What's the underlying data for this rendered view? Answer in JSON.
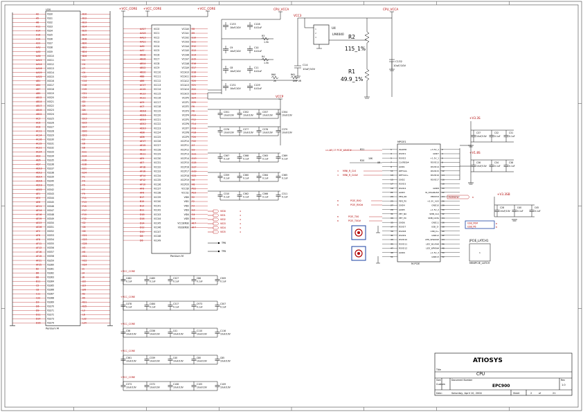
{
  "title_block": {
    "company": "ATIOSYS",
    "sheet_title": "CPU",
    "title_label": "Title",
    "size_label": "Size",
    "size_value": "Custom",
    "doc_label": "Document Number",
    "doc_number": "EPC900",
    "rev_label": "Rev",
    "rev_value": "1.0",
    "date_label": "Date:",
    "date_value": "Saturday, April 10, 2004",
    "sheet_label": "Sheet",
    "sheet_num": "2",
    "of_label": "of",
    "sheet_total": "21"
  },
  "rails": {
    "vcc_core_1": "+VCC_CORE",
    "vcc_core_2": "+VCC_CORE",
    "vcc_core_3": "+VCC_CORE",
    "cpu_vcca_1": "CPU_VCCA",
    "cpu_vcca_2": "CPU_VCCA",
    "vcc3": "VCC3",
    "vccp": "VCCP",
    "v3_3sb": "+V3.3S",
    "v1_8s": "+V1.8S",
    "v3_3sb_2": "+V3.3SB"
  },
  "left_part": {
    "ref": "U20",
    "caption": "Pentium M",
    "rows": [
      [
        "A2",
        "VSS0",
        "B10"
      ],
      [
        "A5",
        "VSS1",
        "B12"
      ],
      [
        "A8",
        "VSS2",
        "B13"
      ],
      [
        "A11",
        "VSS3",
        "B14"
      ],
      [
        "A14",
        "VSS4",
        "B15"
      ],
      [
        "A16",
        "VSS5",
        "B17"
      ],
      [
        "A19",
        "VSS6",
        "B18"
      ],
      [
        "A23",
        "VSS7",
        "B20"
      ],
      [
        "AA2",
        "VSS8",
        "B22"
      ],
      [
        "AA5",
        "VSS9",
        "B24"
      ],
      [
        "AA8",
        "VSS10",
        "B26"
      ],
      [
        "AA11",
        "VSS11",
        "C1"
      ],
      [
        "AA14",
        "VSS12",
        "C4"
      ],
      [
        "AA16",
        "VSS13",
        "C7"
      ],
      [
        "AA19",
        "VSS14",
        "C9"
      ],
      [
        "AA22",
        "VSS15",
        "C12"
      ],
      [
        "AB1",
        "VSS16",
        "C14"
      ],
      [
        "AB4",
        "VSS17",
        "C16"
      ],
      [
        "AB7",
        "VSS18",
        "C19"
      ],
      [
        "AB9",
        "VSS19",
        "C21"
      ],
      [
        "AB12",
        "VSS20",
        "C24"
      ],
      [
        "AB14",
        "VSS21",
        "D2"
      ],
      [
        "AB17",
        "VSS22",
        "D5"
      ],
      [
        "AB19",
        "VSS23",
        "D8"
      ],
      [
        "AB22",
        "VSS24",
        "D10"
      ],
      [
        "AC3",
        "VSS25",
        "D13"
      ],
      [
        "AC6",
        "VSS26",
        "D15"
      ],
      [
        "AC8",
        "VSS27",
        "D17"
      ],
      [
        "AC11",
        "VSS28",
        "D20"
      ],
      [
        "AC14",
        "VSS29",
        "D23"
      ],
      [
        "AC16",
        "VSS30",
        "E3"
      ],
      [
        "AC19",
        "VSS31",
        "E6"
      ],
      [
        "AC21",
        "VSS32",
        "E8"
      ],
      [
        "AC24",
        "VSS33",
        "E11"
      ],
      [
        "AD2",
        "VSS34",
        "E14"
      ],
      [
        "AD5",
        "VSS35",
        "E16"
      ],
      [
        "AD7",
        "VSS36",
        "E18"
      ],
      [
        "AD10",
        "VSS37",
        "E21"
      ],
      [
        "AD12",
        "VSS38",
        "E24"
      ],
      [
        "AD14",
        "VSS39",
        "F1"
      ],
      [
        "AD16",
        "VSS40",
        "F4"
      ],
      [
        "AD19",
        "VSS41",
        "F5"
      ],
      [
        "AD22",
        "VSS42",
        "F7"
      ],
      [
        "AE1",
        "VSS43",
        "F9"
      ],
      [
        "AE4",
        "VSS44",
        "F11"
      ],
      [
        "AE8",
        "VSS45",
        "F13"
      ],
      [
        "AE11",
        "VSS46",
        "F15"
      ],
      [
        "AE14",
        "VSS47",
        "F17"
      ],
      [
        "AE16",
        "VSS48",
        "F19"
      ],
      [
        "AE19",
        "VSS49",
        "F22"
      ],
      [
        "AE23",
        "VSS50",
        "G2"
      ],
      [
        "AE26",
        "VSS51",
        "G6"
      ],
      [
        "AF2",
        "VSS52",
        "G8"
      ],
      [
        "AF6",
        "VSS53",
        "G21"
      ],
      [
        "AF8",
        "VSS54",
        "G23"
      ],
      [
        "AF11",
        "VSS55",
        "G25"
      ],
      [
        "AF13",
        "VSS56",
        "H3"
      ],
      [
        "AF16",
        "VSS57",
        "H5"
      ],
      [
        "AF19",
        "VSS58",
        "H21"
      ],
      [
        "AF21",
        "VSS59",
        "H22"
      ],
      [
        "AF25",
        "VSS60",
        "H24"
      ],
      [
        "B2",
        "VSS61",
        "J1"
      ],
      [
        "B6",
        "VSS62",
        "J4"
      ],
      [
        "B8",
        "VSS63",
        "J6"
      ],
      [
        "B11",
        "VSS64",
        "J22"
      ],
      [
        "C5",
        "VSS65",
        "J23"
      ],
      [
        "C8",
        "VSS66",
        "J26"
      ],
      [
        "C11",
        "VSS67",
        "K2"
      ],
      [
        "C22",
        "VSS68",
        "K5"
      ],
      [
        "D3",
        "VSS69",
        "K21"
      ],
      [
        "D6",
        "VSS70",
        "K25"
      ],
      [
        "D9",
        "VSS71",
        "L3"
      ],
      [
        "D11",
        "VSS72",
        "L6"
      ],
      [
        "D14",
        "VSS73",
        "L22"
      ],
      [
        "D16",
        "VSS74",
        "L24"
      ]
    ]
  },
  "mid_part": {
    "caption": "Pentium M",
    "left_pins": [
      "AA17",
      "AA15",
      "AA13",
      "AA11",
      "AA9",
      "AA7",
      "AB18",
      "AB16",
      "AB14",
      "AB12",
      "AB10",
      "AB8",
      "AB6",
      "AC17",
      "AC15",
      "AC13",
      "AC11",
      "AC9",
      "AC7",
      "AD18",
      "AD16",
      "AD14",
      "AD12",
      "AD10",
      "AD8",
      "AD6",
      "AE17",
      "AE15",
      "AE13",
      "AE11",
      "AE9",
      "AE7",
      "AF18",
      "AF16",
      "AF14",
      "AF12",
      "AF10",
      "AF8",
      "AF6",
      "B17",
      "B15",
      "B13",
      "B11",
      "D18",
      "D16",
      "D14",
      "D12",
      "D10",
      "D8",
      "D6"
    ],
    "left_names": [
      "VCC0",
      "VCC1",
      "VCC2",
      "VCC3",
      "VCC4",
      "VCC5",
      "VCC6",
      "VCC7",
      "VCC8",
      "VCC9",
      "VCC10",
      "VCC11",
      "VCC12",
      "VCC13",
      "VCC14",
      "VCC15",
      "VCC16",
      "VCC17",
      "VCC18",
      "VCC19",
      "VCC20",
      "VCC21",
      "VCC22",
      "VCC23",
      "VCC24",
      "VCC25",
      "VCC26",
      "VCC27",
      "VCC28",
      "VCC29",
      "VCC30",
      "VCC31",
      "VCC32",
      "VCC33",
      "VCC34",
      "VCC35",
      "VCC36",
      "VCC37",
      "VCC38",
      "VCC39",
      "VCC40",
      "VCC41",
      "VCC42",
      "VCC43",
      "VCC44",
      "VCC45",
      "VCC46",
      "VCC47",
      "VCC48",
      "VCC49"
    ],
    "right_names": [
      "VCCA0",
      "VCCA1",
      "VCCA2",
      "VCCA3",
      "VCCA4",
      "VCCA5",
      "VCCA6",
      "VCCA7",
      "VCCA8",
      "VCCA9",
      "VCCA10",
      "VCCA11",
      "VCCA12",
      "VCCA13",
      "VCCA14",
      "VCCA15",
      "VCCP0",
      "VCCP1",
      "VCCP2",
      "VCCP3",
      "VCCP4",
      "VCCP5",
      "VCCP6",
      "VCCP7",
      "VCCP8",
      "VCCP9",
      "VCCP10",
      "VCCP11",
      "VCCP12",
      "VCCP13",
      "VCCP14",
      "VCCP15",
      "VCCP16",
      "VCCP17",
      "VCCP18",
      "VCCP19",
      "VCCP20",
      "VCCQ0",
      "VCCQ1",
      "VID0",
      "VID1",
      "VID2",
      "VID3",
      "VID4",
      "VID5",
      "VCCSENSE",
      "VSSSENSE"
    ],
    "right_pins": [
      "E8",
      "E9",
      "E10",
      "E11",
      "E12",
      "E13",
      "E14",
      "E15",
      "E16",
      "E17",
      "E18",
      "E19",
      "E20",
      "E21",
      "E22",
      "E23",
      "E24",
      "E25",
      "F6",
      "F8",
      "F10",
      "F12",
      "F14",
      "F16",
      "F18",
      "F20",
      "F22",
      "G7",
      "G9",
      "G11",
      "G13",
      "G15",
      "G17",
      "G19",
      "G21",
      "H6",
      "H8",
      "P22",
      "P23",
      "E2",
      "F2",
      "F3",
      "G3",
      "G4",
      "H4",
      "AE7",
      "AF7"
    ],
    "vid_nets": [
      "VID0",
      "VID1",
      "VID2",
      "VID3",
      "VID4",
      "VID5"
    ],
    "sense_nets": [
      "TP6",
      "TP8"
    ]
  },
  "caps_top": [
    {
      "ref": "C133",
      "val": "10uF/10V"
    },
    {
      "ref": "C128",
      "val": "0.01uF"
    },
    {
      "ref": "C9",
      "val": "10uF/10V"
    },
    {
      "ref": "C10",
      "val": "0.01uF"
    },
    {
      "ref": "C8",
      "val": "10uF/10V"
    },
    {
      "ref": "C11",
      "val": "0.01uF"
    },
    {
      "ref": "C131",
      "val": "10uF/10V"
    },
    {
      "ref": "C129",
      "val": "0.01uF"
    }
  ],
  "res_top": [
    {
      "ref": "R3",
      "val": "1.5k"
    },
    {
      "ref": "R4",
      "val": "1.5k"
    },
    {
      "ref": "R60",
      "val": "2k"
    },
    {
      "ref": "R61",
      "val": "DNP 0R"
    }
  ],
  "reg_block": {
    "ic_ref": "U4",
    "ic_part": "LM4040",
    "r2_ref": "R2",
    "r2_val": "115_1%",
    "r1_ref": "R1",
    "r1_val": "49.9_1%",
    "c14_ref": "C14",
    "c14_val": "10uF/10V",
    "c132_ref": "C132",
    "c132_val": "10uF/10V"
  },
  "cap_grid_mid": [
    {
      "ref": "C351",
      "val": "10uF/10V"
    },
    {
      "ref": "C352",
      "val": "10uF/10V"
    },
    {
      "ref": "C357",
      "val": "10uF/10V"
    },
    {
      "ref": "C354",
      "val": "10uF/10V"
    },
    {
      "ref": "C376",
      "val": "10uF/10V"
    },
    {
      "ref": "C377",
      "val": "10uF/10V"
    },
    {
      "ref": "C378",
      "val": "10uF/10V"
    },
    {
      "ref": "C379",
      "val": "10uF/10V"
    },
    {
      "ref": "C367",
      "val": "0.1uF"
    },
    {
      "ref": "C368",
      "val": "0.1uF"
    },
    {
      "ref": "C363",
      "val": "0.1uF"
    },
    {
      "ref": "C369",
      "val": "0.1uF"
    },
    {
      "ref": "C359",
      "val": "0.1uF"
    },
    {
      "ref": "C360",
      "val": "0.1uF"
    },
    {
      "ref": "C364",
      "val": "0.1uF"
    },
    {
      "ref": "C365",
      "val": "0.1uF"
    },
    {
      "ref": "C310",
      "val": "0.1uF"
    },
    {
      "ref": "C362",
      "val": "0.1uF"
    },
    {
      "ref": "C366",
      "val": "0.1uF"
    },
    {
      "ref": "C311",
      "val": "0.1uF"
    }
  ],
  "cap_grid_bottom": [
    {
      "ref": "C482",
      "val": "0.1uF"
    },
    {
      "ref": "C485",
      "val": "0.1uF"
    },
    {
      "ref": "C327",
      "val": "0.1uF"
    },
    {
      "ref": "C86",
      "val": "0.1uF"
    },
    {
      "ref": "C309",
      "val": "0.1uF"
    },
    {
      "ref": "C478",
      "val": "0.1uF"
    },
    {
      "ref": "C484",
      "val": "0.1uF"
    },
    {
      "ref": "C317",
      "val": "0.1uF"
    },
    {
      "ref": "C973",
      "val": "0.1uF"
    },
    {
      "ref": "C307",
      "val": "0.1uF"
    },
    {
      "ref": "C36",
      "val": "10uF/10V"
    },
    {
      "ref": "C336",
      "val": "10uF/10V"
    },
    {
      "ref": "C41",
      "val": "10uF/10V"
    },
    {
      "ref": "C110",
      "val": "10uF/10V"
    },
    {
      "ref": "C116",
      "val": "10uF/10V"
    },
    {
      "ref": "C361",
      "val": "10uF/10V"
    },
    {
      "ref": "C339",
      "val": "10uF/10V"
    },
    {
      "ref": "C40",
      "val": "10uF/10V"
    },
    {
      "ref": "C80",
      "val": "10uF/10V"
    },
    {
      "ref": "C85",
      "val": "10uF/10V"
    },
    {
      "ref": "C373",
      "val": "10uF/10V"
    },
    {
      "ref": "C372",
      "val": "10uF/10V"
    },
    {
      "ref": "C108",
      "val": "10uF/10V"
    },
    {
      "ref": "C105",
      "val": "10uF/10V"
    },
    {
      "ref": "C109",
      "val": "10uF/10V"
    }
  ],
  "mpcie": {
    "ref": "MPCIE1",
    "caption": "M-PCIE",
    "left_pins": [
      "1",
      "3",
      "5",
      "7",
      "9",
      "11",
      "13",
      "15",
      "17",
      "19",
      "21",
      "23",
      "25",
      "27",
      "29",
      "31",
      "33",
      "35",
      "37",
      "39",
      "41",
      "43",
      "45",
      "47",
      "49",
      "51"
    ],
    "left_names": [
      "WAKE#",
      "RSVD1",
      "RSVD2",
      "CLKREQ#",
      "GND1",
      "REFCLK-",
      "REFCLK+",
      "GND2",
      "RSVD3",
      "RSVD4",
      "GND3",
      "PER_N0",
      "PER_P0",
      "GND4",
      "GND5",
      "PET_N0",
      "PET_P0",
      "GND6",
      "RSVD7",
      "RSVD8",
      "RSVD9",
      "RSVD10",
      "RSVD11",
      "RSVD12",
      "GND9",
      ""
    ],
    "right_names": [
      "+3.3V_1",
      "GND7",
      "+1.5V_1",
      "RSVD13",
      "RSVD14",
      "RSVD15",
      "RSVD16",
      "RSVD17",
      "",
      "GND8",
      "W_DISABLE#",
      "PERST#",
      "+3.3V_AUX",
      "GND10",
      "+1.5V_2",
      "SMB_CLK",
      "SMB_DATA",
      "GND11",
      "USB_D-",
      "USB_D+",
      "GND12",
      "LED_WWAN#",
      "LED_WLAN#",
      "LED_WPAN#",
      "+1.5V_3",
      "GND13",
      "+3.3V_2"
    ],
    "right_pins": [
      "2",
      "4",
      "6",
      "8",
      "10",
      "12",
      "14",
      "16",
      "18",
      "20",
      "22",
      "24",
      "26",
      "28",
      "30",
      "32",
      "34",
      "36",
      "38",
      "40",
      "42",
      "44",
      "46",
      "48",
      "50",
      "52"
    ],
    "net_wake": "13,17  PCIE_WAKE#",
    "net_clk": "MINI_R_CLK",
    "net_clkb": "MINI_R_CLK#",
    "net_rx": "PCIE_RX0",
    "net_rxb": "PCIE_RX0#",
    "net_tx": "PCIE_TX0",
    "net_txb": "PCIE_TX0#",
    "net_rst": "PLTRST#",
    "net_usb": "USB_P6#",
    "net_usbp": "USB_P6",
    "r_wake": "R21",
    "r_wake_val": "10K",
    "r_ck": "R20",
    "r_ck_val": "0R",
    "num_wake": "13,17",
    "num_clk": "3",
    "num_pcie": "8",
    "num_rst": "8",
    "num_usb": "8"
  },
  "right_caps": [
    {
      "ref": "C37",
      "val": "10uF/10V"
    },
    {
      "ref": "C32",
      "val": "0.1uF"
    },
    {
      "ref": "C31",
      "val": "0.1uF"
    },
    {
      "ref": "C36",
      "val": "10uF/10V"
    },
    {
      "ref": "C34",
      "val": "0.1uF"
    },
    {
      "ref": "C38",
      "val": "0.1uF"
    },
    {
      "ref": "C28",
      "val": "10uF/10V"
    },
    {
      "ref": "C40",
      "val": "0.1uF"
    },
    {
      "ref": "C45",
      "val": "0.1uF"
    }
  ],
  "latch": {
    "ref": "JPCIE_LATCH1",
    "part": "MINIPCIE_LATCH",
    "num_label": "1"
  }
}
